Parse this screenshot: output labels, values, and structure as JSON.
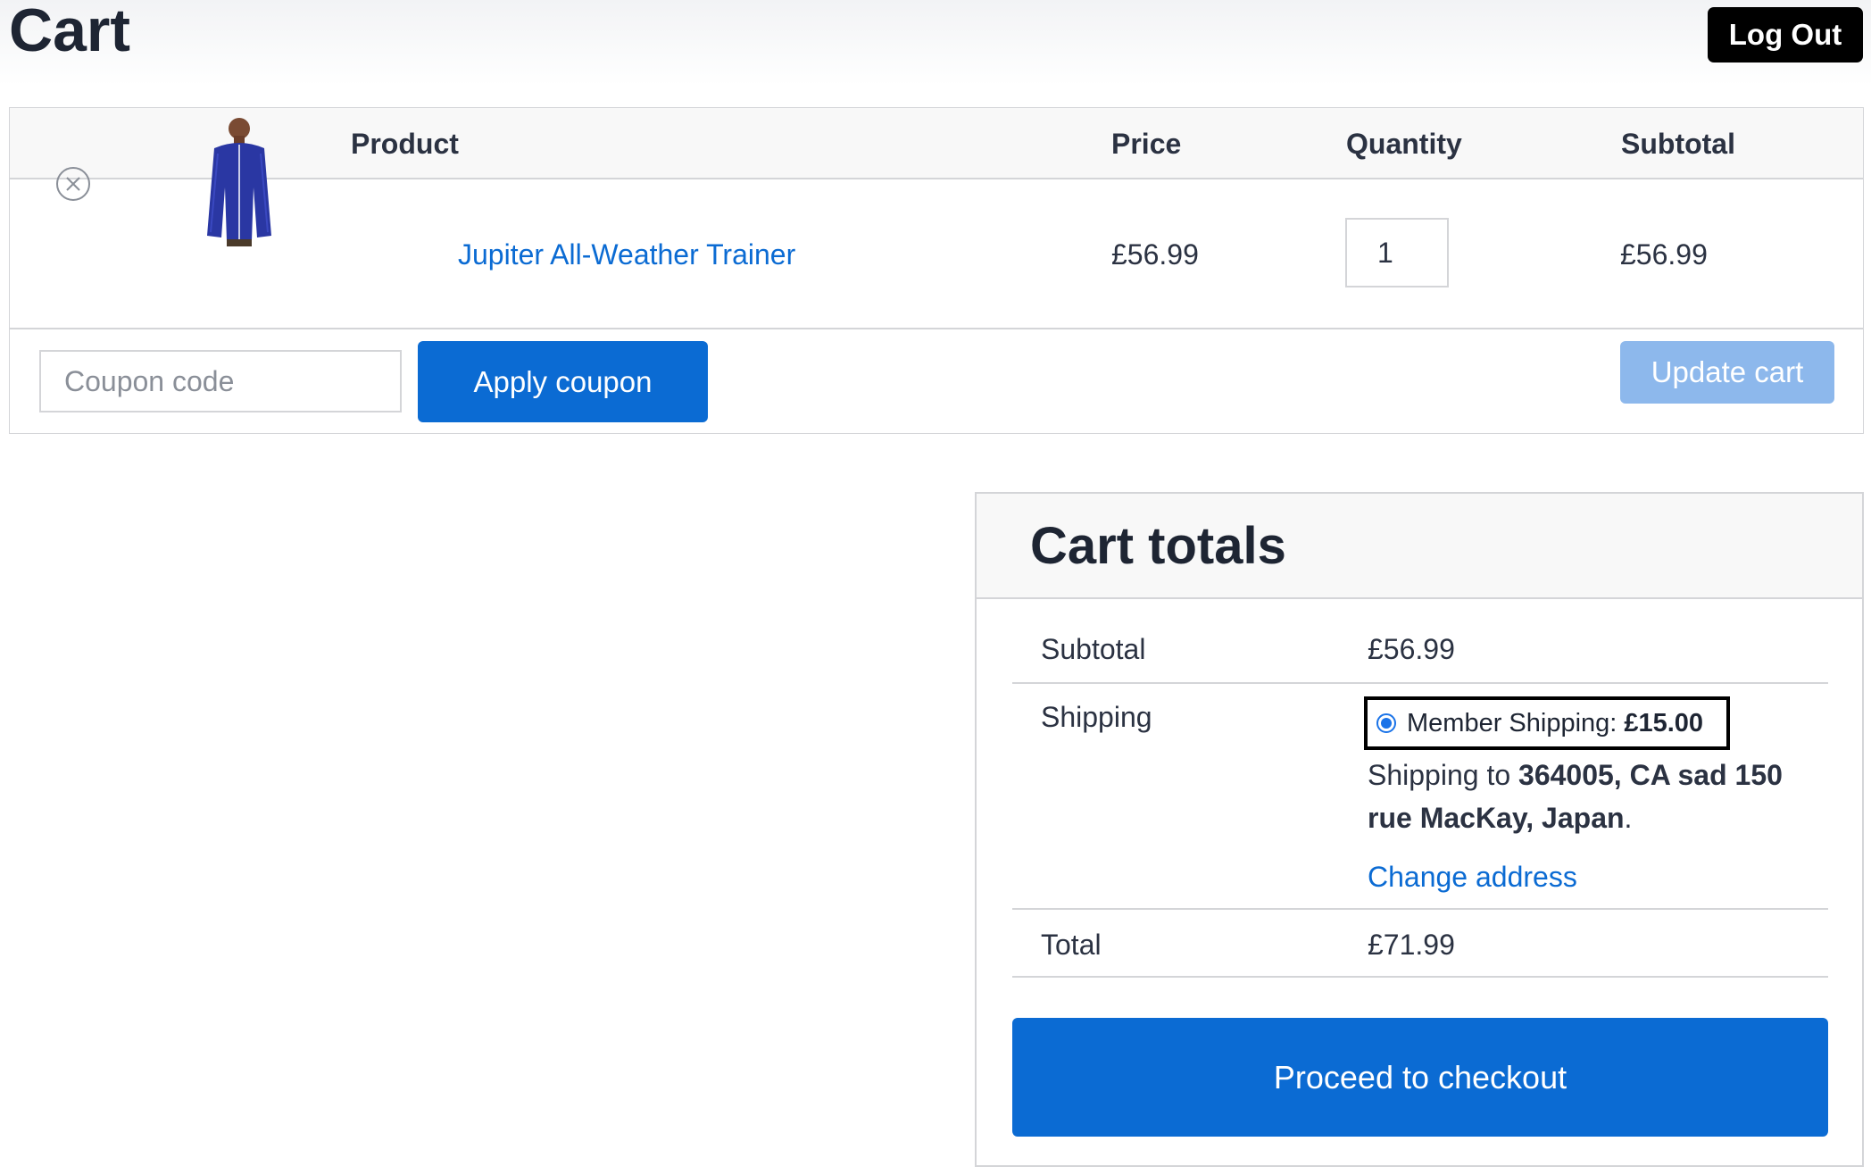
{
  "header": {
    "title": "Cart",
    "logout_label": "Log Out"
  },
  "cart_table": {
    "columns": [
      "Product",
      "Price",
      "Quantity",
      "Subtotal"
    ],
    "items": [
      {
        "product_name": "Jupiter All-Weather Trainer",
        "price": "£56.99",
        "quantity": "1",
        "subtotal": "£56.99",
        "remove_icon": "remove-circle-x-icon",
        "thumbnail": "jacket-image"
      }
    ],
    "coupon_placeholder": "Coupon code",
    "apply_coupon_label": "Apply coupon",
    "update_cart_label": "Update cart"
  },
  "cart_totals": {
    "title": "Cart totals",
    "subtotal_label": "Subtotal",
    "subtotal_value": "£56.99",
    "shipping_label": "Shipping",
    "shipping_option_label": "Member Shipping:",
    "shipping_option_price": "£15.00",
    "shipping_to_prefix": "Shipping to",
    "shipping_to_address": "364005, CA sad 150 rue MacKay, Japan",
    "shipping_to_suffix": ".",
    "change_address_label": "Change address",
    "total_label": "Total",
    "total_value": "£71.99",
    "checkout_label": "Proceed to checkout"
  },
  "colors": {
    "accent": "#0b6bd3",
    "update_disabled": "#8db8ec",
    "logout_bg": "#000000",
    "border": "#d4d5d8"
  }
}
